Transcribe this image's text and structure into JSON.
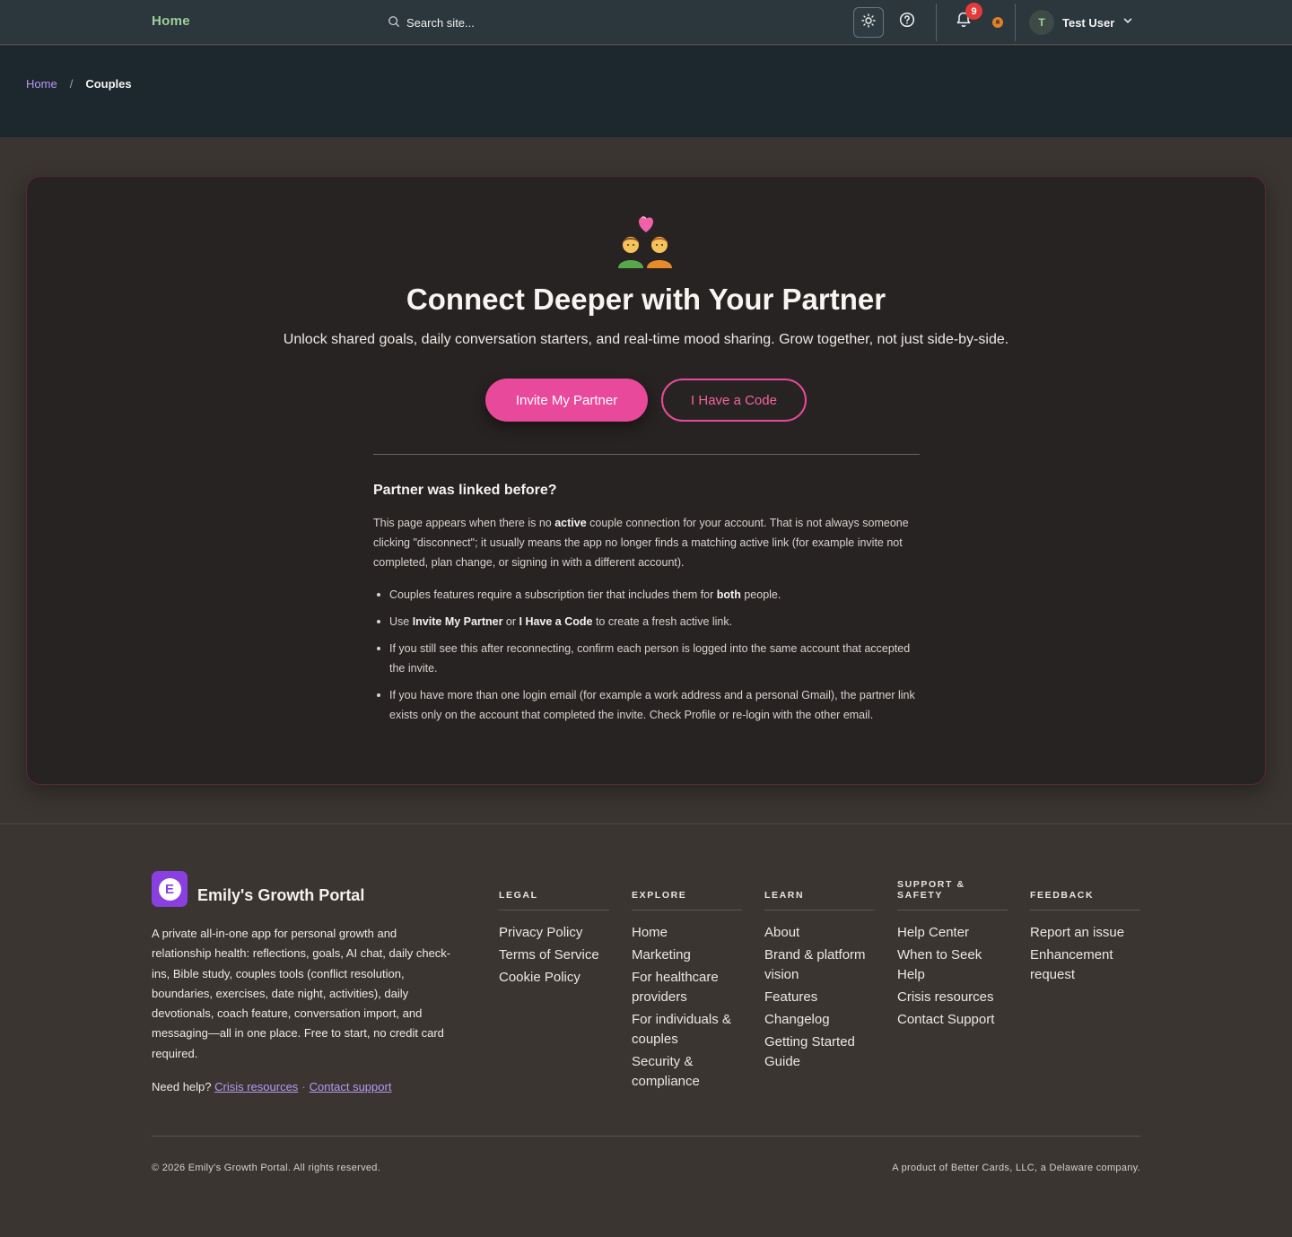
{
  "nav": {
    "home_label": "Home",
    "search_placeholder": "Search site...",
    "notification_count": "9",
    "user_initial": "T",
    "user_name": "Test User"
  },
  "breadcrumb": {
    "home": "Home",
    "separator": "/",
    "current": "Couples"
  },
  "hero": {
    "emoji": "💑",
    "title": "Connect Deeper with Your Partner",
    "subtitle": "Unlock shared goals, daily conversation starters, and real-time mood sharing. Grow together, not just side-by-side.",
    "invite_button": "Invite My Partner",
    "code_button": "I Have a Code"
  },
  "info": {
    "heading": "Partner was linked before?",
    "para_before": "This page appears when there is no ",
    "para_bold": "active",
    "para_after": " couple connection for your account. That is not always someone clicking \"disconnect\"; it usually means the app no longer finds a matching active link (for example invite not completed, plan change, or signing in with a different account).",
    "bullet1_before": "Couples features require a subscription tier that includes them for ",
    "bullet1_bold": "both",
    "bullet1_after": " people.",
    "bullet2_use": "Use ",
    "bullet2_bold1": "Invite My Partner",
    "bullet2_or": " or ",
    "bullet2_bold2": "I Have a Code",
    "bullet2_after": " to create a fresh active link.",
    "bullet3": "If you still see this after reconnecting, confirm each person is logged into the same account that accepted the invite.",
    "bullet4": "If you have more than one login email (for example a work address and a personal Gmail), the partner link exists only on the account that completed the invite. Check Profile or re-login with the other email."
  },
  "footer": {
    "brand_letter": "E",
    "brand_name": "Emily's Growth Portal",
    "description": "A private all-in-one app for personal growth and relationship health: reflections, goals, AI chat, daily check-ins, Bible study, couples tools (conflict resolution, boundaries, exercises, date night, activities), daily devotionals, coach feature, conversation import, and messaging—all in one place. Free to start, no credit card required.",
    "need_help": "Need help?",
    "crisis_link": "Crisis resources",
    "separator": "·",
    "contact_link": "Contact support",
    "columns": {
      "legal": {
        "title": "LEGAL",
        "items": [
          "Privacy Policy",
          "Terms of Service",
          "Cookie Policy"
        ]
      },
      "explore": {
        "title": "EXPLORE",
        "items": [
          "Home",
          "Marketing",
          "For healthcare providers",
          "For individuals & couples",
          "Security & compliance"
        ]
      },
      "learn": {
        "title": "LEARN",
        "items": [
          "About",
          "Brand & platform vision",
          "Features",
          "Changelog",
          "Getting Started Guide"
        ]
      },
      "support": {
        "title": "SUPPORT & SAFETY",
        "items": [
          "Help Center",
          "When to Seek Help",
          "Crisis resources",
          "Contact Support"
        ]
      },
      "feedback": {
        "title": "FEEDBACK",
        "items": [
          "Report an issue",
          "Enhancement request"
        ]
      }
    },
    "copyright": "© 2026 Emily's Growth Portal. All rights reserved.",
    "product_of": "A product of Better Cards, LLC, a Delaware company."
  },
  "colors": {
    "accent_pink": "#e9499a",
    "link_purple": "#b599f2",
    "nav_home_green": "#9fcf9a",
    "badge_red": "#e53a3a",
    "brand_purple": "#8a3fe0"
  }
}
